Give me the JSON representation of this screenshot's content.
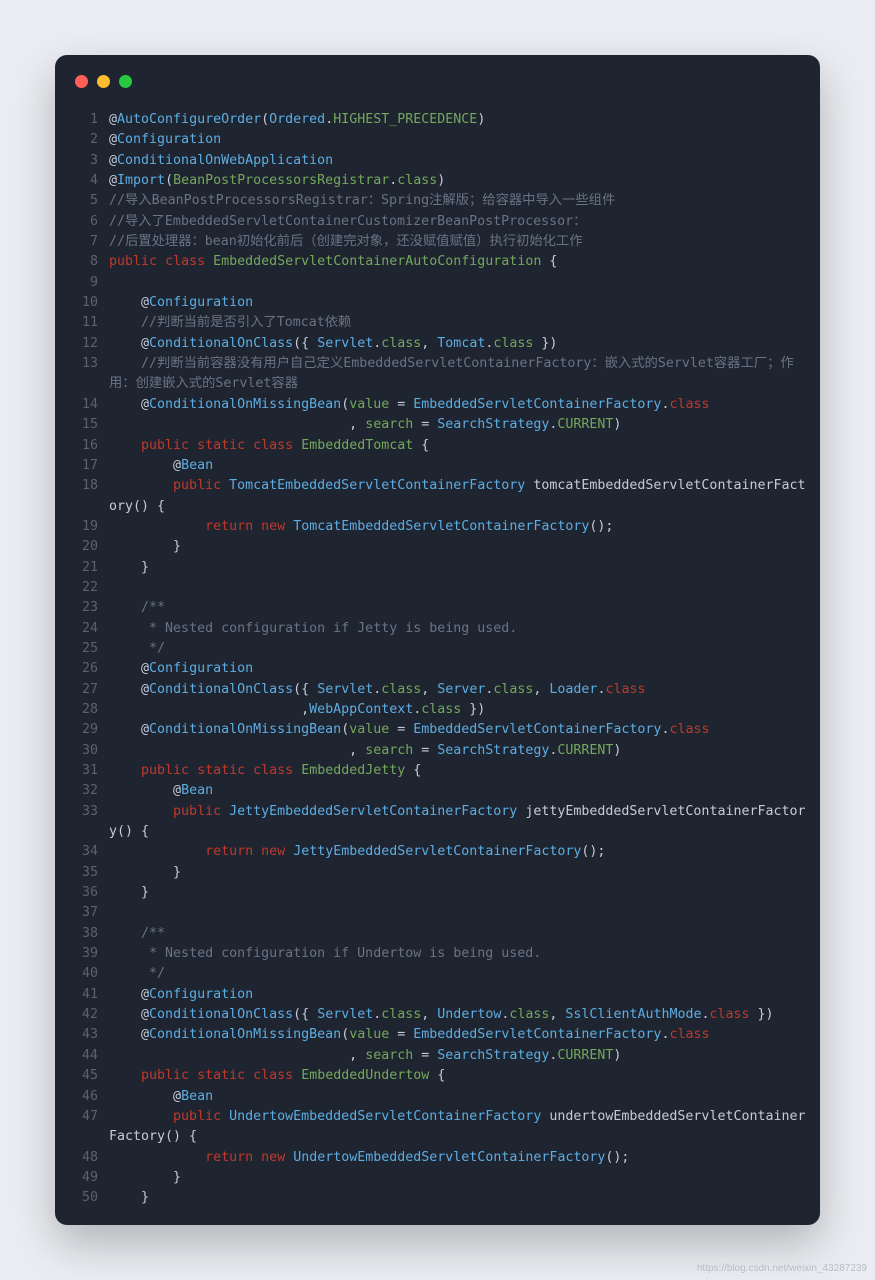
{
  "watermark": "https://blog.csdn.net/weixin_43287239",
  "lines": [
    {
      "n": 1,
      "tokens": [
        [
          "cls",
          "@"
        ],
        [
          "type",
          "AutoConfigureOrder"
        ],
        [
          "pun",
          "("
        ],
        [
          "type",
          "Ordered"
        ],
        [
          "pun",
          "."
        ],
        [
          "typeY",
          "HIGHEST_PRECEDENCE"
        ],
        [
          "pun",
          ")"
        ]
      ]
    },
    {
      "n": 2,
      "tokens": [
        [
          "cls",
          "@"
        ],
        [
          "type",
          "Configuration"
        ]
      ]
    },
    {
      "n": 3,
      "tokens": [
        [
          "cls",
          "@"
        ],
        [
          "type",
          "ConditionalOnWebApplication"
        ]
      ]
    },
    {
      "n": 4,
      "tokens": [
        [
          "cls",
          "@"
        ],
        [
          "type",
          "Import"
        ],
        [
          "pun",
          "("
        ],
        [
          "typeY",
          "BeanPostProcessorsRegistrar"
        ],
        [
          "pun",
          "."
        ],
        [
          "typeY",
          "class"
        ],
        [
          "pun",
          ")"
        ]
      ]
    },
    {
      "n": 5,
      "tokens": [
        [
          "cmt",
          "//导入BeanPostProcessorsRegistrar：Spring注解版；给容器中导入一些组件"
        ]
      ]
    },
    {
      "n": 6,
      "tokens": [
        [
          "cmt",
          "//导入了EmbeddedServletContainerCustomizerBeanPostProcessor："
        ]
      ]
    },
    {
      "n": 7,
      "tokens": [
        [
          "cmt",
          "//后置处理器：bean初始化前后（创建完对象，还没赋值赋值）执行初始化工作"
        ]
      ]
    },
    {
      "n": 8,
      "tokens": [
        [
          "kw",
          "public"
        ],
        [
          "pun",
          " "
        ],
        [
          "kw",
          "class"
        ],
        [
          "pun",
          " "
        ],
        [
          "typeY",
          "EmbeddedServletContainerAutoConfiguration"
        ],
        [
          "pun",
          " {"
        ]
      ]
    },
    {
      "n": 9,
      "tokens": [
        [
          "pun",
          ""
        ]
      ]
    },
    {
      "n": 10,
      "tokens": [
        [
          "pun",
          "    "
        ],
        [
          "cls",
          "@"
        ],
        [
          "type",
          "Configuration"
        ]
      ]
    },
    {
      "n": 11,
      "tokens": [
        [
          "pun",
          "    "
        ],
        [
          "cmt",
          "//判断当前是否引入了Tomcat依赖"
        ]
      ]
    },
    {
      "n": 12,
      "tokens": [
        [
          "pun",
          "    "
        ],
        [
          "cls",
          "@"
        ],
        [
          "type",
          "ConditionalOnClass"
        ],
        [
          "pun",
          "({ "
        ],
        [
          "type",
          "Servlet"
        ],
        [
          "pun",
          "."
        ],
        [
          "typeY",
          "class"
        ],
        [
          "pun",
          ", "
        ],
        [
          "type",
          "Tomcat"
        ],
        [
          "pun",
          "."
        ],
        [
          "typeY",
          "class"
        ],
        [
          "pun",
          " })"
        ]
      ]
    },
    {
      "n": 13,
      "tokens": [
        [
          "pun",
          "    "
        ],
        [
          "cmt",
          "//判断当前容器没有用户自己定义EmbeddedServletContainerFactory：嵌入式的Servlet容器工厂；作用：创建嵌入式的Servlet容器"
        ]
      ]
    },
    {
      "n": 14,
      "tokens": [
        [
          "pun",
          "    "
        ],
        [
          "cls",
          "@"
        ],
        [
          "type",
          "ConditionalOnMissingBean"
        ],
        [
          "pun",
          "("
        ],
        [
          "typeY",
          "value"
        ],
        [
          "pun",
          " = "
        ],
        [
          "type",
          "EmbeddedServletContainerFactory"
        ],
        [
          "pun",
          "."
        ],
        [
          "kw",
          "class"
        ]
      ]
    },
    {
      "n": 15,
      "tokens": [
        [
          "pun",
          "                              , "
        ],
        [
          "typeY",
          "search"
        ],
        [
          "pun",
          " = "
        ],
        [
          "type",
          "SearchStrategy"
        ],
        [
          "pun",
          "."
        ],
        [
          "typeY",
          "CURRENT"
        ],
        [
          "pun",
          ")"
        ]
      ]
    },
    {
      "n": 16,
      "tokens": [
        [
          "pun",
          "    "
        ],
        [
          "kw",
          "public"
        ],
        [
          "pun",
          " "
        ],
        [
          "kw",
          "static"
        ],
        [
          "pun",
          " "
        ],
        [
          "kw",
          "class"
        ],
        [
          "pun",
          " "
        ],
        [
          "typeY",
          "EmbeddedTomcat"
        ],
        [
          "pun",
          " {"
        ]
      ]
    },
    {
      "n": 17,
      "tokens": [
        [
          "pun",
          "        "
        ],
        [
          "cls",
          "@"
        ],
        [
          "type",
          "Bean"
        ]
      ]
    },
    {
      "n": 18,
      "tokens": [
        [
          "pun",
          "        "
        ],
        [
          "kw",
          "public"
        ],
        [
          "pun",
          " "
        ],
        [
          "type",
          "TomcatEmbeddedServletContainerFactory"
        ],
        [
          "pun",
          " tomcatEmbeddedServletContainerFactory() {"
        ]
      ]
    },
    {
      "n": 19,
      "tokens": [
        [
          "pun",
          "            "
        ],
        [
          "kw",
          "return"
        ],
        [
          "pun",
          " "
        ],
        [
          "kw",
          "new"
        ],
        [
          "pun",
          " "
        ],
        [
          "type",
          "TomcatEmbeddedServletContainerFactory"
        ],
        [
          "pun",
          "();"
        ]
      ]
    },
    {
      "n": 20,
      "tokens": [
        [
          "pun",
          "        }"
        ]
      ]
    },
    {
      "n": 21,
      "tokens": [
        [
          "pun",
          "    }"
        ]
      ]
    },
    {
      "n": 22,
      "tokens": [
        [
          "pun",
          ""
        ]
      ]
    },
    {
      "n": 23,
      "tokens": [
        [
          "pun",
          "    "
        ],
        [
          "cmt",
          "/**"
        ]
      ]
    },
    {
      "n": 24,
      "tokens": [
        [
          "pun",
          "    "
        ],
        [
          "cmt",
          " * Nested configuration if Jetty is being used."
        ]
      ]
    },
    {
      "n": 25,
      "tokens": [
        [
          "pun",
          "    "
        ],
        [
          "cmt",
          " */"
        ]
      ]
    },
    {
      "n": 26,
      "tokens": [
        [
          "pun",
          "    "
        ],
        [
          "cls",
          "@"
        ],
        [
          "type",
          "Configuration"
        ]
      ]
    },
    {
      "n": 27,
      "tokens": [
        [
          "pun",
          "    "
        ],
        [
          "cls",
          "@"
        ],
        [
          "type",
          "ConditionalOnClass"
        ],
        [
          "pun",
          "({ "
        ],
        [
          "type",
          "Servlet"
        ],
        [
          "pun",
          "."
        ],
        [
          "typeY",
          "class"
        ],
        [
          "pun",
          ", "
        ],
        [
          "type",
          "Server"
        ],
        [
          "pun",
          "."
        ],
        [
          "typeY",
          "class"
        ],
        [
          "pun",
          ", "
        ],
        [
          "type",
          "Loader"
        ],
        [
          "pun",
          "."
        ],
        [
          "kw",
          "class"
        ]
      ]
    },
    {
      "n": 28,
      "tokens": [
        [
          "pun",
          "                        ,"
        ],
        [
          "type",
          "WebAppContext"
        ],
        [
          "pun",
          "."
        ],
        [
          "typeY",
          "class"
        ],
        [
          "pun",
          " })"
        ]
      ]
    },
    {
      "n": 29,
      "tokens": [
        [
          "pun",
          "    "
        ],
        [
          "cls",
          "@"
        ],
        [
          "type",
          "ConditionalOnMissingBean"
        ],
        [
          "pun",
          "("
        ],
        [
          "typeY",
          "value"
        ],
        [
          "pun",
          " = "
        ],
        [
          "type",
          "EmbeddedServletContainerFactory"
        ],
        [
          "pun",
          "."
        ],
        [
          "kw",
          "class"
        ]
      ]
    },
    {
      "n": 30,
      "tokens": [
        [
          "pun",
          "                              , "
        ],
        [
          "typeY",
          "search"
        ],
        [
          "pun",
          " = "
        ],
        [
          "type",
          "SearchStrategy"
        ],
        [
          "pun",
          "."
        ],
        [
          "typeY",
          "CURRENT"
        ],
        [
          "pun",
          ")"
        ]
      ]
    },
    {
      "n": 31,
      "tokens": [
        [
          "pun",
          "    "
        ],
        [
          "kw",
          "public"
        ],
        [
          "pun",
          " "
        ],
        [
          "kw",
          "static"
        ],
        [
          "pun",
          " "
        ],
        [
          "kw",
          "class"
        ],
        [
          "pun",
          " "
        ],
        [
          "typeY",
          "EmbeddedJetty"
        ],
        [
          "pun",
          " {"
        ]
      ]
    },
    {
      "n": 32,
      "tokens": [
        [
          "pun",
          "        "
        ],
        [
          "cls",
          "@"
        ],
        [
          "type",
          "Bean"
        ]
      ]
    },
    {
      "n": 33,
      "tokens": [
        [
          "pun",
          "        "
        ],
        [
          "kw",
          "public"
        ],
        [
          "pun",
          " "
        ],
        [
          "type",
          "JettyEmbeddedServletContainerFactory"
        ],
        [
          "pun",
          " jettyEmbeddedServletContainerFactory() {"
        ]
      ]
    },
    {
      "n": 34,
      "tokens": [
        [
          "pun",
          "            "
        ],
        [
          "kw",
          "return"
        ],
        [
          "pun",
          " "
        ],
        [
          "kw",
          "new"
        ],
        [
          "pun",
          " "
        ],
        [
          "type",
          "JettyEmbeddedServletContainerFactory"
        ],
        [
          "pun",
          "();"
        ]
      ]
    },
    {
      "n": 35,
      "tokens": [
        [
          "pun",
          "        }"
        ]
      ]
    },
    {
      "n": 36,
      "tokens": [
        [
          "pun",
          "    }"
        ]
      ]
    },
    {
      "n": 37,
      "tokens": [
        [
          "pun",
          ""
        ]
      ]
    },
    {
      "n": 38,
      "tokens": [
        [
          "pun",
          "    "
        ],
        [
          "cmt",
          "/**"
        ]
      ]
    },
    {
      "n": 39,
      "tokens": [
        [
          "pun",
          "    "
        ],
        [
          "cmt",
          " * Nested configuration if Undertow is being used."
        ]
      ]
    },
    {
      "n": 40,
      "tokens": [
        [
          "pun",
          "    "
        ],
        [
          "cmt",
          " */"
        ]
      ]
    },
    {
      "n": 41,
      "tokens": [
        [
          "pun",
          "    "
        ],
        [
          "cls",
          "@"
        ],
        [
          "type",
          "Configuration"
        ]
      ]
    },
    {
      "n": 42,
      "tokens": [
        [
          "pun",
          "    "
        ],
        [
          "cls",
          "@"
        ],
        [
          "type",
          "ConditionalOnClass"
        ],
        [
          "pun",
          "({ "
        ],
        [
          "type",
          "Servlet"
        ],
        [
          "pun",
          "."
        ],
        [
          "typeY",
          "class"
        ],
        [
          "pun",
          ", "
        ],
        [
          "type",
          "Undertow"
        ],
        [
          "pun",
          "."
        ],
        [
          "typeY",
          "class"
        ],
        [
          "pun",
          ", "
        ],
        [
          "type",
          "SslClientAuthMode"
        ],
        [
          "pun",
          "."
        ],
        [
          "kw",
          "class"
        ],
        [
          "pun",
          " })"
        ]
      ]
    },
    {
      "n": 43,
      "tokens": [
        [
          "pun",
          "    "
        ],
        [
          "cls",
          "@"
        ],
        [
          "type",
          "ConditionalOnMissingBean"
        ],
        [
          "pun",
          "("
        ],
        [
          "typeY",
          "value"
        ],
        [
          "pun",
          " = "
        ],
        [
          "type",
          "EmbeddedServletContainerFactory"
        ],
        [
          "pun",
          "."
        ],
        [
          "kw",
          "class"
        ]
      ]
    },
    {
      "n": 44,
      "tokens": [
        [
          "pun",
          "                              , "
        ],
        [
          "typeY",
          "search"
        ],
        [
          "pun",
          " = "
        ],
        [
          "type",
          "SearchStrategy"
        ],
        [
          "pun",
          "."
        ],
        [
          "typeY",
          "CURRENT"
        ],
        [
          "pun",
          ")"
        ]
      ]
    },
    {
      "n": 45,
      "tokens": [
        [
          "pun",
          "    "
        ],
        [
          "kw",
          "public"
        ],
        [
          "pun",
          " "
        ],
        [
          "kw",
          "static"
        ],
        [
          "pun",
          " "
        ],
        [
          "kw",
          "class"
        ],
        [
          "pun",
          " "
        ],
        [
          "typeY",
          "EmbeddedUndertow"
        ],
        [
          "pun",
          " {"
        ]
      ]
    },
    {
      "n": 46,
      "tokens": [
        [
          "pun",
          "        "
        ],
        [
          "cls",
          "@"
        ],
        [
          "type",
          "Bean"
        ]
      ]
    },
    {
      "n": 47,
      "tokens": [
        [
          "pun",
          "        "
        ],
        [
          "kw",
          "public"
        ],
        [
          "pun",
          " "
        ],
        [
          "type",
          "UndertowEmbeddedServletContainerFactory"
        ],
        [
          "pun",
          " undertowEmbeddedServletContainerFactory() {"
        ]
      ]
    },
    {
      "n": 48,
      "tokens": [
        [
          "pun",
          "            "
        ],
        [
          "kw",
          "return"
        ],
        [
          "pun",
          " "
        ],
        [
          "kw",
          "new"
        ],
        [
          "pun",
          " "
        ],
        [
          "type",
          "UndertowEmbeddedServletContainerFactory"
        ],
        [
          "pun",
          "();"
        ]
      ]
    },
    {
      "n": 49,
      "tokens": [
        [
          "pun",
          "        }"
        ]
      ]
    },
    {
      "n": 50,
      "tokens": [
        [
          "pun",
          "    }"
        ]
      ]
    }
  ]
}
